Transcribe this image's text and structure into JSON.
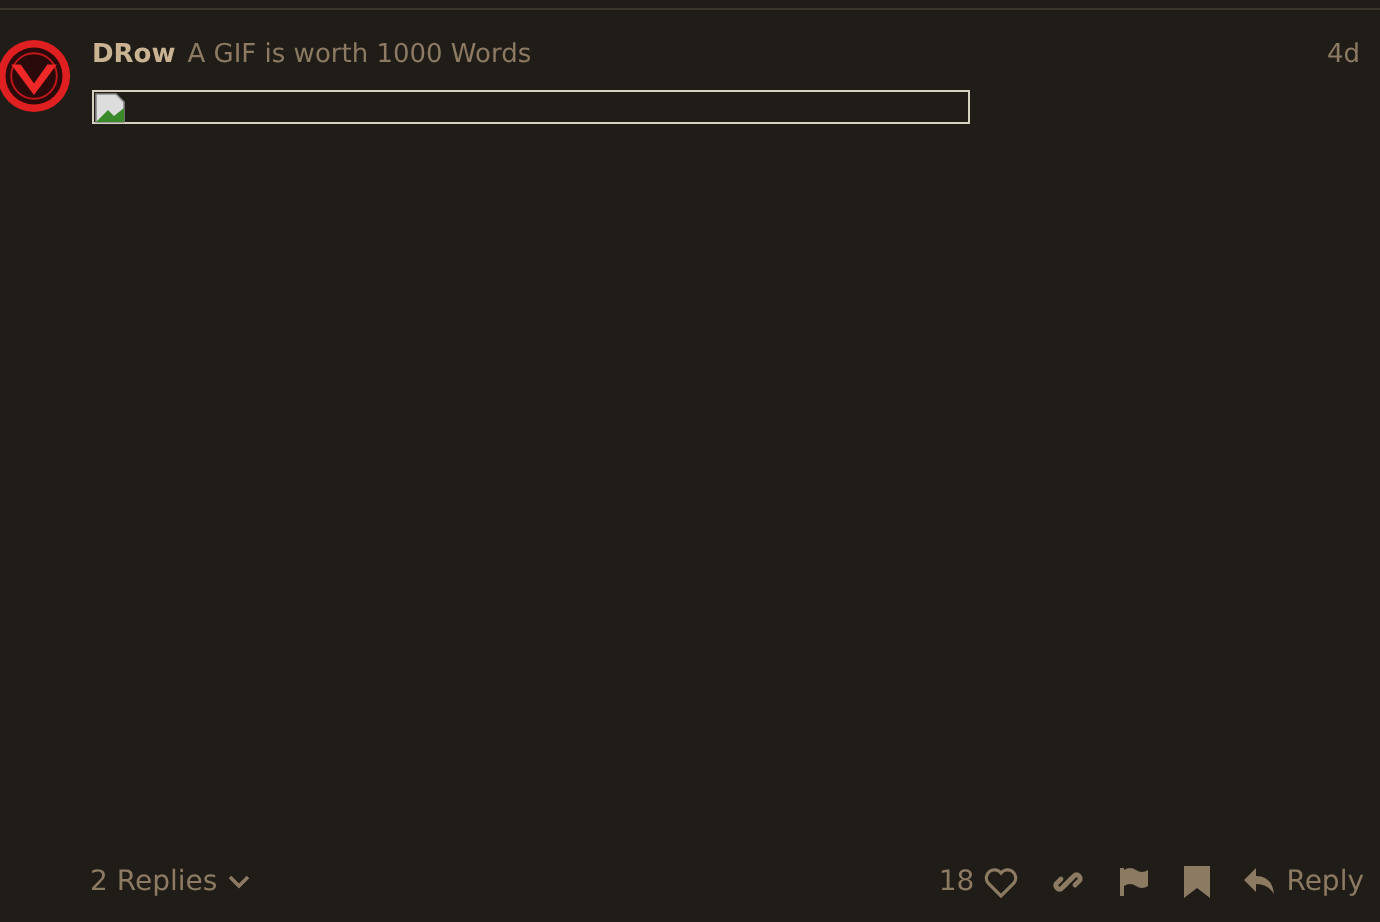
{
  "post": {
    "username": "DRow",
    "user_title": "A GIF is worth 1000 Words",
    "age": "4d"
  },
  "footer": {
    "replies": "2 Replies",
    "like_count": "18",
    "reply": "Reply"
  }
}
